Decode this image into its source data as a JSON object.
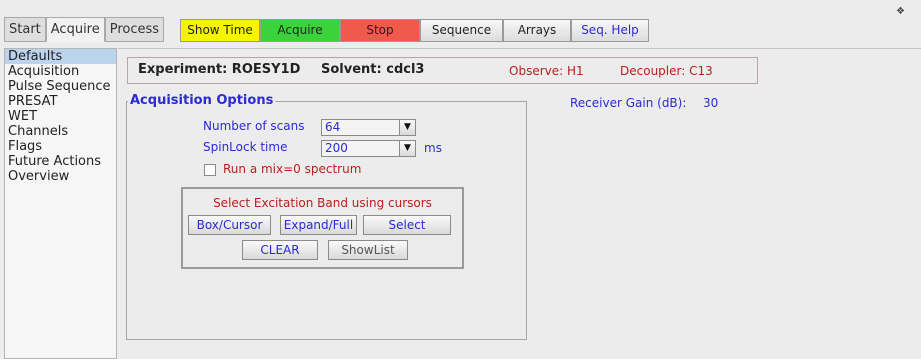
{
  "tabs": [
    "Start",
    "Acquire",
    "Process"
  ],
  "active_tab": "Acquire",
  "toolbar": {
    "show_time": "Show Time",
    "acquire": "Acquire",
    "stop": "Stop",
    "sequence": "Sequence",
    "arrays": "Arrays",
    "seq_help": "Seq. Help"
  },
  "toolbar_colors": {
    "show_time": "#f5f500",
    "acquire": "#3ad43a",
    "stop": "#f05a4a"
  },
  "nav": [
    "Defaults",
    "Acquisition",
    "Pulse Sequence",
    "PRESAT",
    "WET",
    "Channels",
    "Flags",
    "Future Actions",
    "Overview"
  ],
  "nav_selected": "Defaults",
  "header": {
    "experiment": "Experiment: ROESY1D",
    "solvent": "Solvent: cdcl3",
    "observe": "Observe: H1",
    "decoupler": "Decoupler: C13"
  },
  "acquisition": {
    "title": "Acquisition Options",
    "scans_label": "Number of scans",
    "scans_value": "64",
    "spinlock_label": "SpinLock time",
    "spinlock_value": "200",
    "spinlock_unit": "ms",
    "mix_label": "Run a mix=0 spectrum",
    "mix_checked": false
  },
  "band": {
    "title": "Select Excitation Band using cursors",
    "box_cursor": "Box/Cursor",
    "expand_full": "Expand/Full",
    "select": "Select",
    "clear": "CLEAR",
    "showlist": "ShowList"
  },
  "receiver": {
    "label": "Receiver Gain (dB):",
    "value": "30"
  }
}
